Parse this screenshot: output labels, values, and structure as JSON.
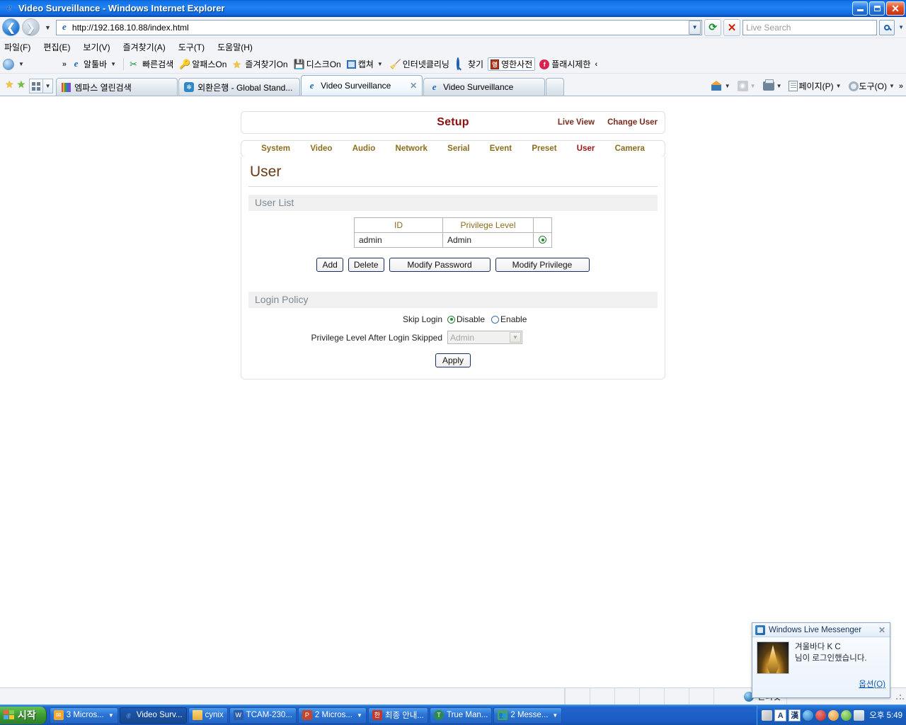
{
  "window": {
    "title": "Video Surveillance - Windows Internet Explorer",
    "icon": "ie-icon",
    "minimize": "minimize-button",
    "restore": "restore-button",
    "close": "close-button"
  },
  "address_bar": {
    "url": "http://192.168.10.88/index.html",
    "back": "back-button",
    "forward": "forward-button",
    "refresh": "refresh-button",
    "stop": "stop-button",
    "search_placeholder": "Live Search",
    "search_value": ""
  },
  "menu": [
    {
      "label": "파일(F)",
      "text": "파일",
      "key": "F"
    },
    {
      "label": "편집(E)",
      "text": "편집",
      "key": "E"
    },
    {
      "label": "보기(V)",
      "text": "보기",
      "key": "V"
    },
    {
      "label": "즐겨찾기(A)",
      "text": "즐겨찾기",
      "key": "A"
    },
    {
      "label": "도구(T)",
      "text": "도구",
      "key": "T"
    },
    {
      "label": "도움말(H)",
      "text": "도움말",
      "key": "H"
    }
  ],
  "addon_toolbar": [
    {
      "label": "알툴바",
      "icon": "ie-icon",
      "dropdown": true
    },
    {
      "label": "빠른검색",
      "icon": "scissors-icon"
    },
    {
      "label": "알패스On",
      "icon": "key-icon"
    },
    {
      "label": "즐겨찾기On",
      "icon": "star-icon"
    },
    {
      "label": "디스크On",
      "icon": "disk-icon"
    },
    {
      "label": "캡쳐",
      "icon": "capture-icon",
      "dropdown": true
    },
    {
      "label": "인터넷클리닝",
      "icon": "broom-icon"
    },
    {
      "label": "찾기",
      "icon": "magnifier-icon"
    },
    {
      "label": "영한사전",
      "icon": "dictionary-icon",
      "boxed": true
    },
    {
      "label": "플래시제한",
      "icon": "flash-block-icon"
    }
  ],
  "tabs": [
    {
      "label": "엠파스 열린검색",
      "icon": "empas-icon",
      "active": false,
      "closable": false
    },
    {
      "label": "외환은행 - Global Stand...",
      "icon": "bank-icon",
      "active": false,
      "closable": false
    },
    {
      "label": "Video Surveillance",
      "icon": "ie-icon",
      "active": true,
      "closable": true
    },
    {
      "label": "Video Surveillance",
      "icon": "ie-icon",
      "active": false,
      "closable": false
    }
  ],
  "tab_tools": {
    "favorites": "favorites-star-icon",
    "add_favorite": "add-favorite-icon",
    "quick_tabs": "quick-tabs-icon",
    "home": "home-icon",
    "feeds": "rss-feed-icon",
    "print": "print-icon",
    "page_label": "페이지(P)",
    "tools_label": "도구(O)"
  },
  "setup": {
    "title": "Setup",
    "title_color": "#8b0f0f",
    "live_view": "Live View",
    "change_user": "Change User",
    "nav": [
      {
        "label": "System",
        "selected": false
      },
      {
        "label": "Video",
        "selected": false
      },
      {
        "label": "Audio",
        "selected": false
      },
      {
        "label": "Network",
        "selected": false
      },
      {
        "label": "Serial",
        "selected": false
      },
      {
        "label": "Event",
        "selected": false
      },
      {
        "label": "Preset",
        "selected": false
      },
      {
        "label": "User",
        "selected": true
      },
      {
        "label": "Camera",
        "selected": false
      }
    ],
    "page_heading": "User",
    "user_list": {
      "section_title": "User List",
      "columns": [
        "ID",
        "Privilege Level",
        ""
      ],
      "rows": [
        {
          "id": "admin",
          "privilege": "Admin",
          "selected": true
        }
      ],
      "buttons": [
        {
          "label": "Add"
        },
        {
          "label": "Delete"
        },
        {
          "label": "Modify Password"
        },
        {
          "label": "Modify Privilege"
        }
      ]
    },
    "login_policy": {
      "section_title": "Login Policy",
      "skip_login_label": "Skip Login",
      "skip_login_options": [
        {
          "label": "Disable",
          "selected": true
        },
        {
          "label": "Enable",
          "selected": false
        }
      ],
      "privilege_label": "Privilege Level After Login Skipped",
      "privilege_value": "Admin",
      "privilege_disabled": true,
      "apply_label": "Apply"
    }
  },
  "status_bar": {
    "zone": "인터넷",
    "zone_icon": "globe-icon"
  },
  "toast": {
    "title": "Windows Live Messenger",
    "icon": "messenger-icon",
    "close": "close-icon",
    "line1": "겨울바다 K C",
    "line2": "님이 로그인했습니다.",
    "options_label": "옵션(O)"
  },
  "taskbar": {
    "start_label": "시작",
    "items": [
      {
        "label": "3 Micros...",
        "icon": "outlook-icon",
        "active": false,
        "dropdown": true
      },
      {
        "label": "Video Surv...",
        "icon": "ie-icon",
        "active": true,
        "dropdown": false
      },
      {
        "label": "cynix",
        "icon": "folder-icon",
        "active": false,
        "dropdown": false
      },
      {
        "label": "TCAM-230...",
        "icon": "word-icon",
        "active": false,
        "dropdown": false
      },
      {
        "label": "2 Micros...",
        "icon": "powerpoint-icon",
        "active": false,
        "dropdown": true
      },
      {
        "label": "최종 안내...",
        "icon": "red-doc-icon",
        "active": false,
        "dropdown": false
      },
      {
        "label": "True Man...",
        "icon": "green-circle-icon",
        "active": false,
        "dropdown": false
      },
      {
        "label": "2 Messe...",
        "icon": "people-icon",
        "active": false,
        "dropdown": true
      }
    ],
    "tray": {
      "ime_mode": "A",
      "ime_hanja": "漢",
      "icons": [
        "pen-icon",
        "back-icon",
        "block-icon",
        "update-icon",
        "shield-icon",
        "clipboard-icon"
      ],
      "clock": "오후 5:49"
    }
  }
}
